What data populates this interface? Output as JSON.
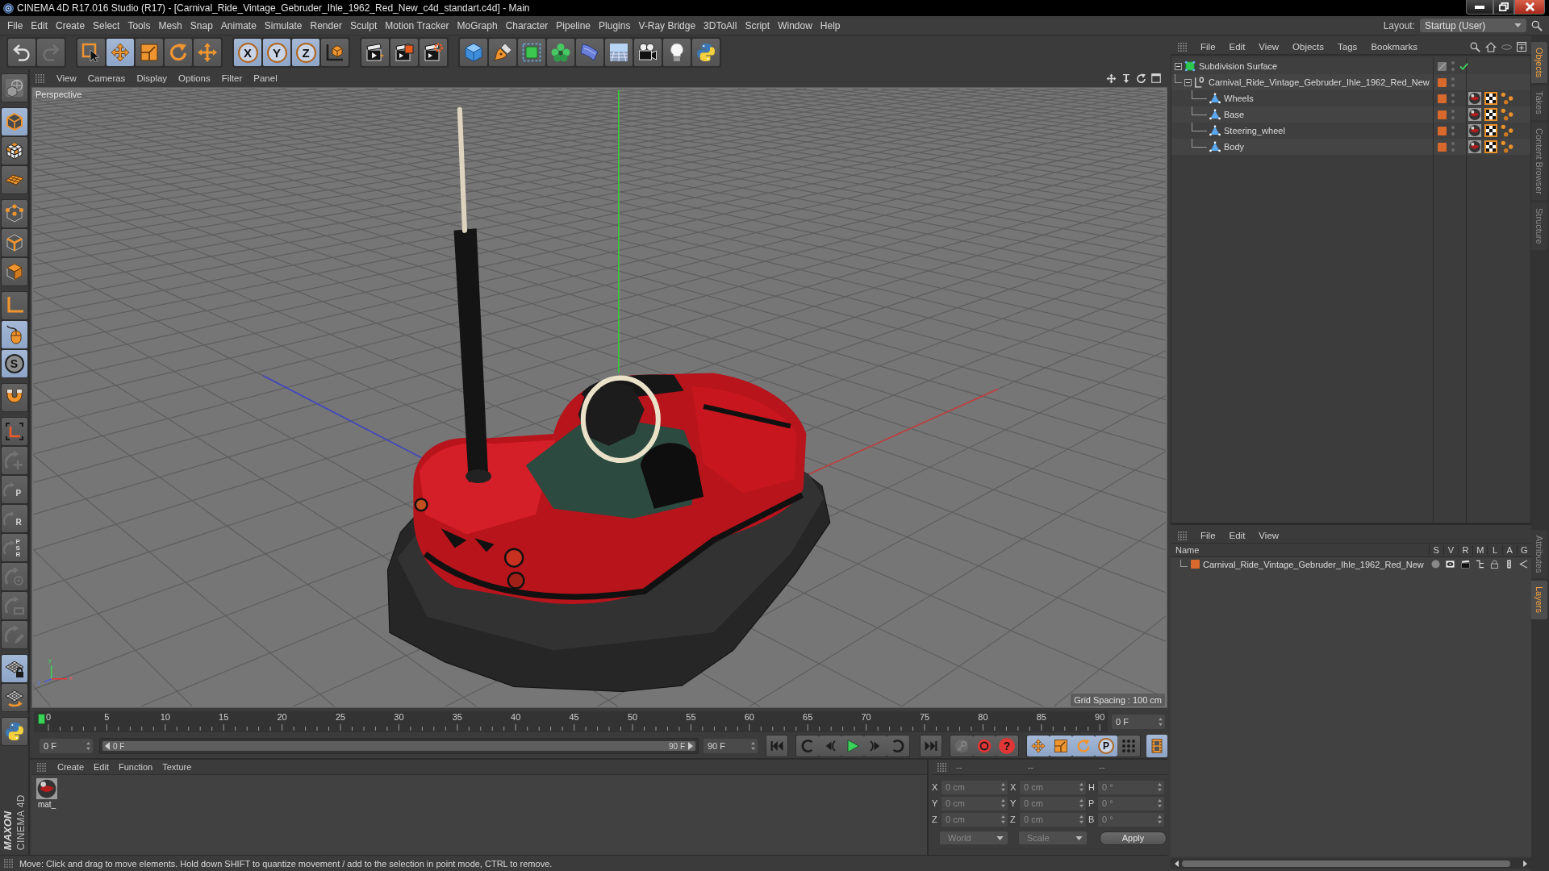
{
  "window": {
    "title": "CINEMA 4D R17.016 Studio (R17) - [Carnival_Ride_Vintage_Gebruder_Ihle_1962_Red_New_c4d_standart.c4d] - Main"
  },
  "menu_bar": {
    "items": [
      "File",
      "Edit",
      "Create",
      "Select",
      "Tools",
      "Mesh",
      "Snap",
      "Animate",
      "Simulate",
      "Render",
      "Sculpt",
      "Motion Tracker",
      "MoGraph",
      "Character",
      "Pipeline",
      "Plugins",
      "V-Ray Bridge",
      "3DToAll",
      "Script",
      "Window",
      "Help"
    ],
    "layout_label": "Layout:",
    "layout_value": "Startup (User)"
  },
  "toolbar": {
    "groups": [
      {
        "buttons": [
          {
            "kind": "undo",
            "selected": false,
            "disabled": false
          },
          {
            "kind": "redo",
            "selected": false,
            "disabled": true
          }
        ]
      },
      {
        "buttons": [
          {
            "kind": "select",
            "selected": false,
            "disabled": false
          },
          {
            "kind": "move",
            "selected": true,
            "disabled": false
          },
          {
            "kind": "scale",
            "selected": false,
            "disabled": false
          },
          {
            "kind": "rotate",
            "selected": false,
            "disabled": false
          },
          {
            "kind": "transform",
            "selected": false,
            "disabled": false
          }
        ]
      },
      {
        "buttons": [
          {
            "kind": "axis",
            "label": "X",
            "selected": true,
            "disabled": false
          },
          {
            "kind": "axis",
            "label": "Y",
            "selected": true,
            "disabled": false
          },
          {
            "kind": "axis",
            "label": "Z",
            "selected": true,
            "disabled": false
          },
          {
            "kind": "world",
            "selected": false,
            "disabled": false
          }
        ]
      },
      {
        "buttons": [
          {
            "kind": "renderview",
            "selected": false,
            "disabled": false
          },
          {
            "kind": "renderpicture",
            "selected": false,
            "disabled": false
          },
          {
            "kind": "rendersettings",
            "selected": false,
            "disabled": false
          }
        ]
      },
      {
        "buttons": [
          {
            "kind": "cube",
            "selected": false,
            "disabled": false
          },
          {
            "kind": "spline",
            "selected": false,
            "disabled": false
          },
          {
            "kind": "subdivision",
            "selected": false,
            "disabled": false
          },
          {
            "kind": "cloner",
            "selected": false,
            "disabled": false
          },
          {
            "kind": "deformer",
            "selected": false,
            "disabled": false
          },
          {
            "kind": "floor",
            "selected": false,
            "disabled": false
          },
          {
            "kind": "camera",
            "selected": false,
            "disabled": false
          },
          {
            "kind": "light",
            "selected": false,
            "disabled": false
          },
          {
            "kind": "python",
            "selected": false,
            "disabled": false
          }
        ]
      }
    ]
  },
  "left_toolbar": {
    "groups": [
      {
        "buttons": [
          {
            "kind": "makeeditable",
            "selected": false,
            "disabled": false
          }
        ]
      },
      {
        "buttons": [
          {
            "kind": "model",
            "selected": true,
            "disabled": false
          },
          {
            "kind": "texture",
            "selected": false,
            "disabled": false
          },
          {
            "kind": "workplane",
            "selected": false,
            "disabled": false
          }
        ]
      },
      {
        "buttons": [
          {
            "kind": "points",
            "selected": false,
            "disabled": false
          },
          {
            "kind": "edges",
            "selected": false,
            "disabled": false
          },
          {
            "kind": "polygons",
            "selected": false,
            "disabled": false
          }
        ]
      },
      {
        "buttons": [
          {
            "kind": "axis",
            "selected": false,
            "disabled": false
          },
          {
            "kind": "tweak",
            "selected": true,
            "disabled": false
          },
          {
            "kind": "solo",
            "label": "S",
            "selected": true,
            "disabled": false
          }
        ]
      },
      {
        "buttons": [
          {
            "kind": "snap",
            "selected": false,
            "disabled": false
          }
        ]
      },
      {
        "buttons": [
          {
            "kind": "axislock",
            "selected": false,
            "disabled": false
          },
          {
            "kind": "keyaxis",
            "selected": false,
            "disabled": true
          },
          {
            "kind": "keyletter",
            "label": "P",
            "selected": false,
            "disabled": true
          },
          {
            "kind": "keyletter",
            "label": "R",
            "selected": false,
            "disabled": true
          },
          {
            "kind": "keyletter",
            "label": "PSR",
            "selected": false,
            "disabled": true
          },
          {
            "kind": "keypoint",
            "selected": false,
            "disabled": true
          },
          {
            "kind": "keyparam",
            "selected": false,
            "disabled": true
          },
          {
            "kind": "keypen",
            "selected": false,
            "disabled": true
          }
        ]
      },
      {
        "buttons": [
          {
            "kind": "lockgrid",
            "selected": true,
            "disabled": false
          },
          {
            "kind": "gridrotate",
            "selected": false,
            "disabled": false
          }
        ]
      },
      {
        "buttons": [
          {
            "kind": "python",
            "selected": false,
            "disabled": false
          }
        ]
      }
    ]
  },
  "viewport": {
    "menu": [
      "View",
      "Cameras",
      "Display",
      "Options",
      "Filter",
      "Panel"
    ],
    "camera": "Perspective",
    "grid_spacing": "Grid Spacing : 100 cm",
    "axis_labels": [
      "y",
      "z",
      "x"
    ]
  },
  "timeline": {
    "ticks": [
      "0",
      "5",
      "10",
      "15",
      "20",
      "25",
      "30",
      "35",
      "40",
      "45",
      "50",
      "55",
      "60",
      "65",
      "70",
      "75",
      "80",
      "85",
      "90"
    ],
    "playhead": {
      "level": 0
    },
    "frame_field": "0 F"
  },
  "transport": {
    "start_field": "0 F",
    "range": {
      "start": "0 F",
      "end": "90 F",
      "level": 1
    },
    "end_field": "90 F",
    "record_label": "?",
    "key_filters": [
      {
        "kind": "move",
        "selected": true
      },
      {
        "kind": "scale",
        "selected": true
      },
      {
        "kind": "rotate",
        "selected": true
      },
      {
        "kind": "param",
        "label": "P",
        "selected": true
      },
      {
        "kind": "points",
        "selected": false
      }
    ],
    "timeline_mode": {
      "selected": true
    }
  },
  "material_manager": {
    "menu": [
      "Create",
      "Edit",
      "Function",
      "Texture"
    ],
    "materials": [
      {
        "name": "mat_"
      }
    ]
  },
  "coordinates": {
    "headers": [
      "--",
      "--",
      "--"
    ],
    "rows": [
      {
        "axis": "X",
        "position": "0 cm",
        "size_axis": "X",
        "size": "0 cm",
        "rotation_axis": "H",
        "rotation": "0 °"
      },
      {
        "axis": "Y",
        "position": "0 cm",
        "size_axis": "Y",
        "size": "0 cm",
        "rotation_axis": "P",
        "rotation": "0 °"
      },
      {
        "axis": "Z",
        "position": "0 cm",
        "size_axis": "Z",
        "size": "0 cm",
        "rotation_axis": "B",
        "rotation": "0 °"
      }
    ],
    "position_mode": "World",
    "size_mode": "Scale",
    "apply": "Apply"
  },
  "logo": {
    "brand": "MAXON",
    "product": "CINEMA 4D"
  },
  "status_bar": {
    "text": "Move: Click and drag to move elements. Hold down SHIFT to quantize movement / add to the selection in point mode, CTRL to remove."
  },
  "object_manager": {
    "menu": [
      "File",
      "Edit",
      "View",
      "Objects",
      "Tags",
      "Bookmarks"
    ],
    "objects": [
      {
        "name": "Subdivision Surface",
        "kind": "generator",
        "expanded": true,
        "on_layer": false,
        "enabled": true,
        "children": [
          {
            "name": "Carnival_Ride_Vintage_Gebruder_Ihle_1962_Red_New",
            "kind": "null",
            "expanded": true,
            "on_layer": true,
            "children": [
              {
                "name": "Wheels",
                "kind": "polygon",
                "on_layer": true,
                "tags": [
                  {
                    "kind": "material"
                  },
                  {
                    "kind": "texture"
                  },
                  {
                    "kind": "points"
                  }
                ]
              },
              {
                "name": "Base",
                "kind": "polygon",
                "on_layer": true,
                "tags": [
                  {
                    "kind": "material"
                  },
                  {
                    "kind": "texture"
                  },
                  {
                    "kind": "points"
                  }
                ]
              },
              {
                "name": "Steering_wheel",
                "kind": "polygon",
                "on_layer": true,
                "tags": [
                  {
                    "kind": "material"
                  },
                  {
                    "kind": "texture"
                  },
                  {
                    "kind": "points"
                  }
                ]
              },
              {
                "name": "Body",
                "kind": "polygon",
                "on_layer": true,
                "tags": [
                  {
                    "kind": "material"
                  },
                  {
                    "kind": "texture"
                  },
                  {
                    "kind": "points"
                  }
                ]
              }
            ]
          }
        ]
      }
    ]
  },
  "layer_manager": {
    "menu": [
      "File",
      "Edit",
      "View"
    ],
    "columns": [
      "Name",
      "S",
      "V",
      "R",
      "M",
      "L",
      "A",
      "G"
    ],
    "layers": [
      {
        "name": "Carnival_Ride_Vintage_Gebruder_Ihle_1962_Red_New"
      }
    ]
  },
  "side_tabs": {
    "top": [
      {
        "label": "Objects",
        "selected": true
      },
      {
        "label": "Takes",
        "selected": false
      },
      {
        "label": "Content Browser",
        "selected": false
      },
      {
        "label": "Structure",
        "selected": false
      }
    ],
    "bottom": [
      {
        "label": "Attributes",
        "selected": false
      },
      {
        "label": "Layers",
        "selected": true
      }
    ]
  }
}
